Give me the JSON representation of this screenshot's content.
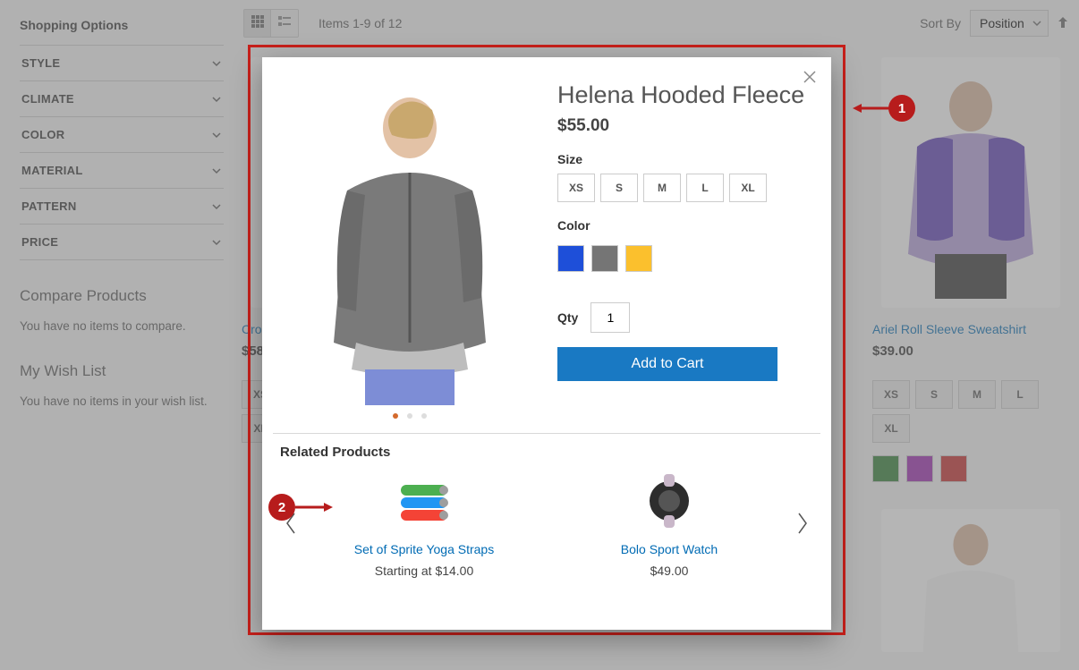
{
  "sidebar": {
    "title": "Shopping Options",
    "filters": [
      "STYLE",
      "CLIMATE",
      "COLOR",
      "MATERIAL",
      "PATTERN",
      "PRICE"
    ],
    "compare": {
      "title": "Compare Products",
      "empty": "You have no items to compare."
    },
    "wishlist": {
      "title": "My Wish List",
      "empty": "You have no items in your wish list."
    }
  },
  "toolbar": {
    "items_text": "Items 1-9 of 12",
    "sort_label": "Sort By",
    "sort_value": "Position"
  },
  "bg_left": {
    "name_partial": "Cro",
    "price": "$58",
    "sizes": [
      "XS"
    ],
    "sizes2": [
      "XL"
    ]
  },
  "bg_right": {
    "name": "Ariel Roll Sleeve Sweatshirt",
    "price": "$39.00",
    "sizes": [
      "XS",
      "S",
      "M",
      "L",
      "XL"
    ],
    "colors": [
      "#2e7d32",
      "#9c27b0",
      "#c62828"
    ]
  },
  "modal": {
    "title": "Helena Hooded Fleece",
    "price": "$55.00",
    "size_label": "Size",
    "sizes": [
      "XS",
      "S",
      "M",
      "L",
      "XL"
    ],
    "color_label": "Color",
    "colors": [
      "#1e4fd9",
      "#757575",
      "#fbc02d"
    ],
    "qty_label": "Qty",
    "qty_value": "1",
    "add_label": "Add to Cart",
    "related_title": "Related Products",
    "related": [
      {
        "name": "Set of Sprite Yoga Straps",
        "price": "Starting at $14.00"
      },
      {
        "name": "Bolo Sport Watch",
        "price": "$49.00"
      }
    ]
  },
  "annotations": {
    "one": "1",
    "two": "2"
  }
}
